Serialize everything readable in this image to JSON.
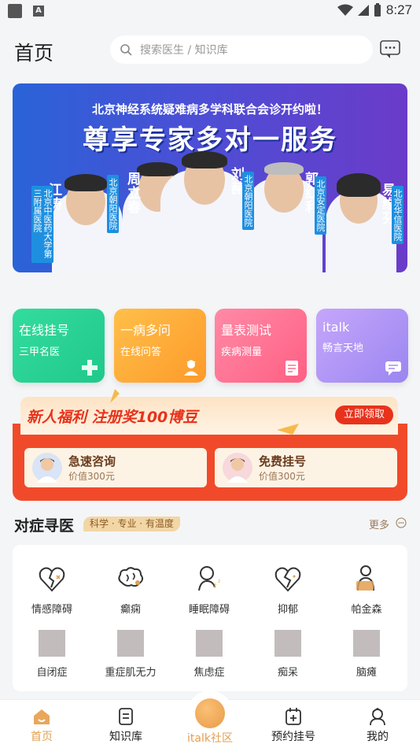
{
  "status": {
    "time": "8:27"
  },
  "header": {
    "title": "首页",
    "search_placeholder": "搜索医生 / 知识库"
  },
  "banner": {
    "subtitle": "北京神经系统疑难病多学科联合会诊开约啦！",
    "headline": "尊享专家多对一服务",
    "doctors": [
      {
        "name": "江涛",
        "hospital": "北京中医药大学第三附属医院"
      },
      {
        "name": "周立春",
        "hospital": "北京朝阳医院"
      },
      {
        "name": "刘赫",
        "hospital": "北京朝阳医院"
      },
      {
        "name": "郭红利",
        "hospital": "北京安定医院"
      },
      {
        "name": "易维芬",
        "hospital": "北京华信医院"
      }
    ]
  },
  "quick": [
    {
      "title": "在线挂号",
      "sub": "三甲名医",
      "icon": "plus-cross-icon"
    },
    {
      "title": "一病多问",
      "sub": "在线问答",
      "icon": "doctor-icon"
    },
    {
      "title": "量表测试",
      "sub": "疾病测量",
      "icon": "clipboard-icon"
    },
    {
      "title": "italk",
      "sub": "畅言天地",
      "icon": "chat-icon"
    }
  ],
  "promo": {
    "text": "新人福利 注册奖100博豆",
    "button": "立即领取",
    "coupons": [
      {
        "title": "急速咨询",
        "sub": "价值300元"
      },
      {
        "title": "免费挂号",
        "sub": "价值300元"
      }
    ]
  },
  "section": {
    "title": "对症寻医",
    "tag": "科学 · 专业 · 有温度",
    "more": "更多"
  },
  "symptoms": [
    {
      "label": "情感障碍",
      "icon": "broken-heart-icon"
    },
    {
      "label": "癫痫",
      "icon": "brain-icon"
    },
    {
      "label": "睡眠障碍",
      "icon": "sleep-person-icon"
    },
    {
      "label": "抑郁",
      "icon": "broken-heart-icon"
    },
    {
      "label": "帕金森",
      "icon": "walker-person-icon"
    },
    {
      "label": "自闭症",
      "icon": "placeholder-icon"
    },
    {
      "label": "重症肌无力",
      "icon": "placeholder-icon"
    },
    {
      "label": "焦虑症",
      "icon": "placeholder-icon"
    },
    {
      "label": "痴呆",
      "icon": "placeholder-icon"
    },
    {
      "label": "脑瘫",
      "icon": "placeholder-icon"
    }
  ],
  "tabs": [
    {
      "label": "首页",
      "icon": "home-icon",
      "active": true
    },
    {
      "label": "知识库",
      "icon": "book-icon"
    },
    {
      "label": "italk社区",
      "icon": "italk-icon"
    },
    {
      "label": "预约挂号",
      "icon": "calendar-icon"
    },
    {
      "label": "我的",
      "icon": "profile-icon"
    }
  ],
  "colors": {
    "accent": "#e2a052",
    "quick_gradients": [
      "#2bd49a",
      "#fdae3a",
      "#ff6f8e",
      "#a58af2"
    ],
    "promo_red": "#f14a2a"
  }
}
